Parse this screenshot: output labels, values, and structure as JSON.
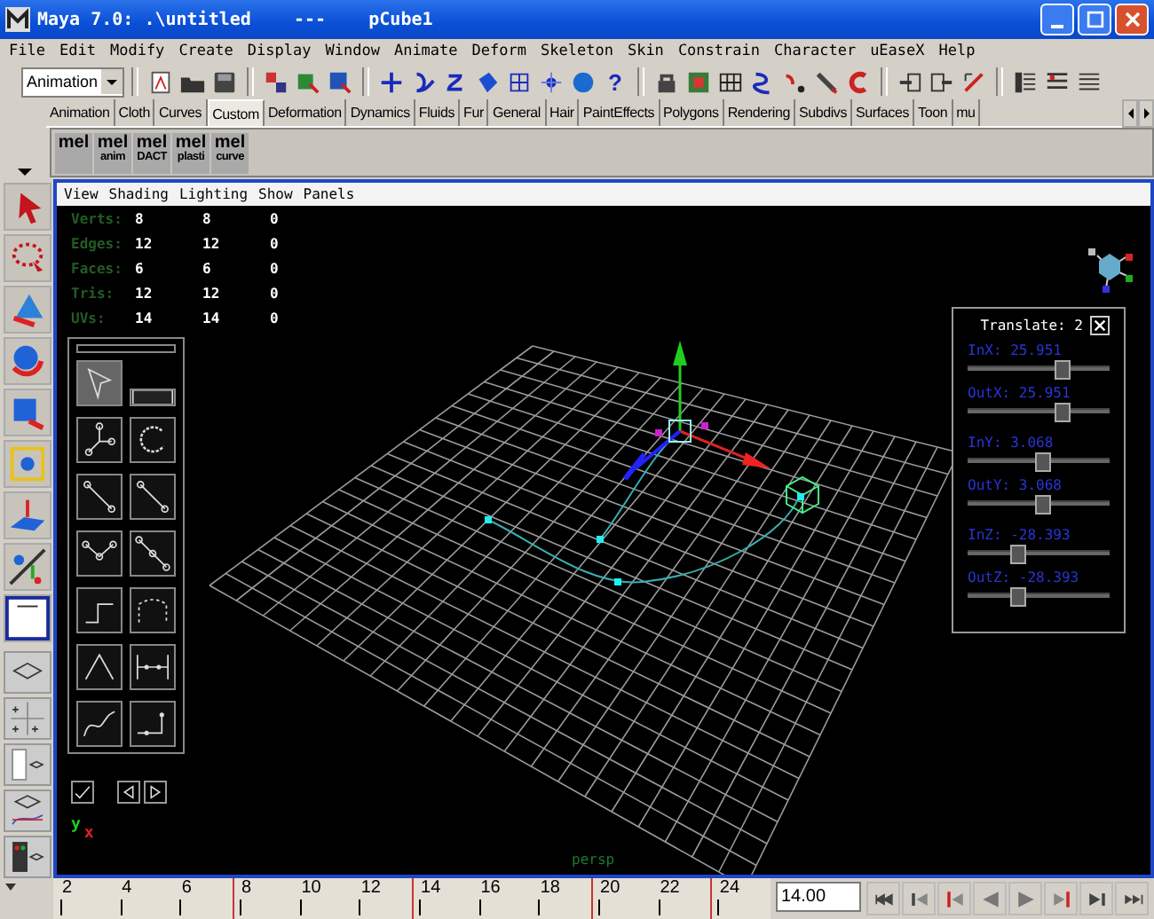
{
  "window": {
    "title": "Maya 7.0: .\\untitled    ---    pCube1"
  },
  "menu": [
    "File",
    "Edit",
    "Modify",
    "Create",
    "Display",
    "Window",
    "Animate",
    "Deform",
    "Skeleton",
    "Skin",
    "Constrain",
    "Character",
    "uEaseX",
    "Help"
  ],
  "toolbar": {
    "mode": "Animation",
    "help_glyph": "?"
  },
  "shelf_tabs": [
    {
      "label": "Animation",
      "selected": false
    },
    {
      "label": "Cloth",
      "selected": false
    },
    {
      "label": "Curves",
      "selected": false
    },
    {
      "label": "Custom",
      "selected": true
    },
    {
      "label": "Deformation",
      "selected": false
    },
    {
      "label": "Dynamics",
      "selected": false
    },
    {
      "label": "Fluids",
      "selected": false
    },
    {
      "label": "Fur",
      "selected": false
    },
    {
      "label": "General",
      "selected": false
    },
    {
      "label": "Hair",
      "selected": false
    },
    {
      "label": "PaintEffects",
      "selected": false
    },
    {
      "label": "Polygons",
      "selected": false
    },
    {
      "label": "Rendering",
      "selected": false
    },
    {
      "label": "Subdivs",
      "selected": false
    },
    {
      "label": "Surfaces",
      "selected": false
    },
    {
      "label": "Toon",
      "selected": false
    },
    {
      "label": "mu",
      "selected": false
    }
  ],
  "shelf_buttons": [
    {
      "icon_text": "mel"
    },
    {
      "icon_text": "mel",
      "label": "anim"
    },
    {
      "icon_text": "mel",
      "label": "DACT"
    },
    {
      "icon_text": "mel",
      "label": "plasti"
    },
    {
      "icon_text": "mel",
      "label": "curve"
    }
  ],
  "viewport": {
    "menu": [
      "View",
      "Shading",
      "Lighting",
      "Show",
      "Panels"
    ],
    "hud": [
      {
        "label": "Verts:",
        "values": [
          "8",
          "8",
          "0"
        ]
      },
      {
        "label": "Edges:",
        "values": [
          "12",
          "12",
          "0"
        ]
      },
      {
        "label": "Faces:",
        "values": [
          "6",
          "6",
          "0"
        ]
      },
      {
        "label": "Tris:",
        "values": [
          "12",
          "12",
          "0"
        ]
      },
      {
        "label": "UVs:",
        "values": [
          "14",
          "14",
          "0"
        ]
      }
    ],
    "curve_tools": [
      {
        "selected": true
      },
      {
        "selected": false
      },
      {
        "selected": false
      },
      {
        "selected": false
      },
      {
        "selected": false
      },
      {
        "selected": false
      },
      {
        "selected": false
      },
      {
        "selected": false
      },
      {
        "selected": false
      },
      {
        "selected": false
      },
      {
        "selected": false
      },
      {
        "selected": false
      },
      {
        "selected": false
      },
      {
        "selected": false
      }
    ],
    "translate_panel": {
      "title": "Translate: 2",
      "sliders": [
        {
          "label": "InX: 25.951",
          "level": 0.66
        },
        {
          "label": "OutX: 25.951",
          "level": 0.66
        },
        {
          "label": "InY: 3.068",
          "level": 0.53
        },
        {
          "label": "OutY: 3.068",
          "level": 0.53
        },
        {
          "label": "InZ: -28.393",
          "level": 0.35
        },
        {
          "label": "OutZ: -28.393",
          "level": 0.35
        }
      ]
    },
    "axis": {
      "y": "y",
      "x": "x"
    },
    "camera": "persp"
  },
  "timeline": {
    "frames": [
      {
        "label": "2",
        "key": false
      },
      {
        "label": "4",
        "key": false
      },
      {
        "label": "6",
        "key": false
      },
      {
        "label": "8",
        "key": true
      },
      {
        "label": "10",
        "key": false
      },
      {
        "label": "12",
        "key": false
      },
      {
        "label": "14",
        "key": true
      },
      {
        "label": "16",
        "key": false
      },
      {
        "label": "18",
        "key": false
      },
      {
        "label": "20",
        "key": true
      },
      {
        "label": "22",
        "key": false
      },
      {
        "label": "24",
        "key": true
      }
    ],
    "current_time": "14.00"
  }
}
